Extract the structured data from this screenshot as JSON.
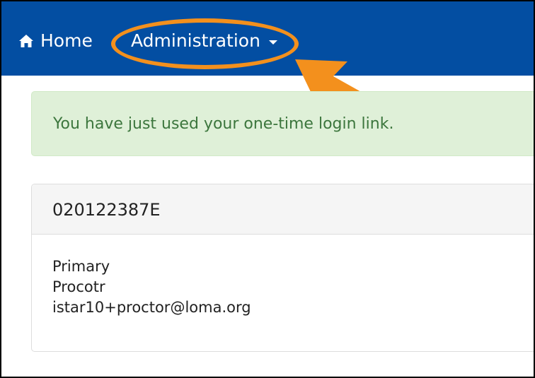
{
  "navbar": {
    "home_label": "Home",
    "admin_label": "Administration",
    "home_icon": "home-icon",
    "dropdown_icon": "caret-down-icon",
    "background_color": "#034ea2"
  },
  "annotation": {
    "color": "#f3901d"
  },
  "alert": {
    "message": "You have just used your one-time login link.",
    "background_color": "#dff0d8",
    "text_color": "#3c763d"
  },
  "panel": {
    "title": "020122387E",
    "lines": [
      "Primary",
      "Procotr",
      "istar10+proctor@loma.org"
    ]
  }
}
